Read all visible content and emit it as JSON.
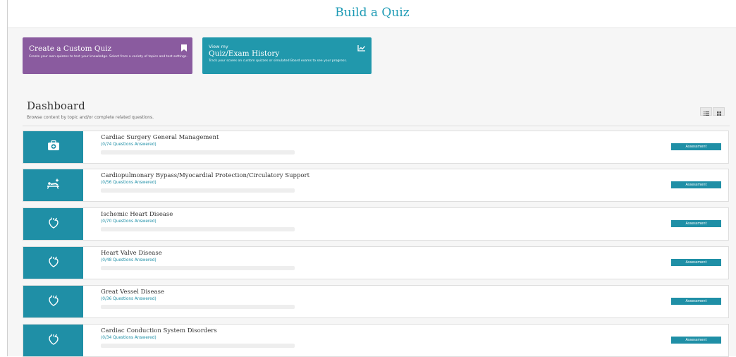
{
  "header": {
    "title": "Build a Quiz"
  },
  "cards": {
    "custom": {
      "title": "Create a Custom Quiz",
      "description": "Create your own quizzes to test your knowledge. Select from a variety of topics and test settings.",
      "icon": "bookmark-icon"
    },
    "history": {
      "pretitle": "View my",
      "title": "Quiz/Exam History",
      "description": "Track your scores on custom quizzes or simulated Board exams to see your progress.",
      "icon": "trend-chart-icon"
    }
  },
  "dashboard": {
    "title": "Dashboard",
    "subtitle": "Browse content by topic and/or complete related questions.",
    "view_icons": [
      "list-view-icon",
      "grid-view-icon"
    ]
  },
  "topics": [
    {
      "name": "Cardiac Surgery General Management",
      "count": "(0/74 Questions Answered)",
      "progress": 0,
      "button": "Assessment",
      "icon": "medical-kit-icon"
    },
    {
      "name": "Cardiopulmonary Bypass/Myocardial Protection/Circulatory Support",
      "count": "(0/56 Questions Answered)",
      "progress": 0,
      "button": "Assessment",
      "icon": "patient-bed-icon"
    },
    {
      "name": "Ischemic Heart Disease",
      "count": "(0/70 Questions Answered)",
      "progress": 0,
      "button": "Assessment",
      "icon": "heart-icon"
    },
    {
      "name": "Heart Valve Disease",
      "count": "(0/48 Questions Answered)",
      "progress": 0,
      "button": "Assessment",
      "icon": "heart-icon"
    },
    {
      "name": "Great Vessel Disease",
      "count": "(0/36 Questions Answered)",
      "progress": 0,
      "button": "Assessment",
      "icon": "heart-icon"
    },
    {
      "name": "Cardiac Conduction System Disorders",
      "count": "(0/34 Questions Answered)",
      "progress": 0,
      "button": "Assessment",
      "icon": "heart-icon"
    }
  ],
  "colors": {
    "teal": "#1f8fa6",
    "purple": "#8a5b9f",
    "title": "#1e9bb5"
  }
}
